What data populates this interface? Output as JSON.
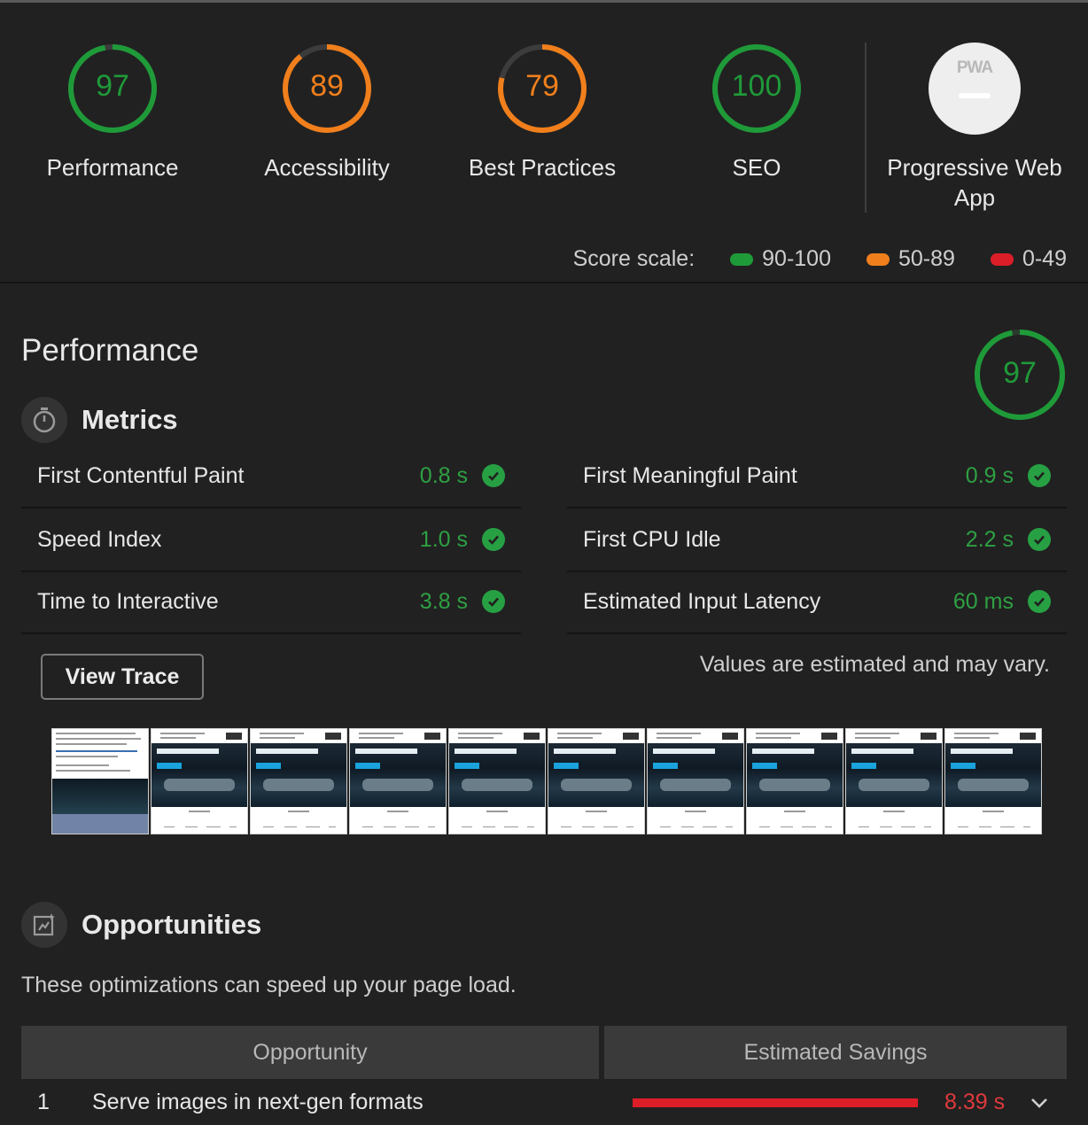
{
  "gauges": [
    {
      "score": 97,
      "fraction": 0.97,
      "label": "Performance",
      "color": "#1f9a39"
    },
    {
      "score": 89,
      "fraction": 0.89,
      "label": "Accessibility",
      "color": "#f07f1c"
    },
    {
      "score": 79,
      "fraction": 0.79,
      "label": "Best Practices",
      "color": "#f07f1c"
    },
    {
      "score": 100,
      "fraction": 1.0,
      "label": "SEO",
      "color": "#1f9a39"
    }
  ],
  "pwa": {
    "badge": "PWA",
    "label": "Progressive Web App"
  },
  "score_scale": {
    "label": "Score scale:",
    "ranges": [
      {
        "text": "90-100",
        "color": "#1f9a39"
      },
      {
        "text": "50-89",
        "color": "#f07f1c"
      },
      {
        "text": "0-49",
        "color": "#dc1e28"
      }
    ]
  },
  "performance": {
    "title": "Performance",
    "score": 97,
    "fraction": 0.97,
    "metrics_heading": "Metrics",
    "metrics": [
      {
        "name": "First Contentful Paint",
        "value": "0.8 s"
      },
      {
        "name": "First Meaningful Paint",
        "value": "0.9 s"
      },
      {
        "name": "Speed Index",
        "value": "1.0 s"
      },
      {
        "name": "First CPU Idle",
        "value": "2.2 s"
      },
      {
        "name": "Time to Interactive",
        "value": "3.8 s"
      },
      {
        "name": "Estimated Input Latency",
        "value": "60 ms"
      }
    ],
    "view_trace": "View Trace",
    "estimate_note": "Values are estimated and may vary."
  },
  "opportunities": {
    "heading": "Opportunities",
    "description": "These optimizations can speed up your page load.",
    "col_opportunity": "Opportunity",
    "col_savings": "Estimated Savings",
    "rows": [
      {
        "index": "1",
        "name": "Serve images in next-gen formats",
        "savings": "8.39 s"
      }
    ]
  }
}
